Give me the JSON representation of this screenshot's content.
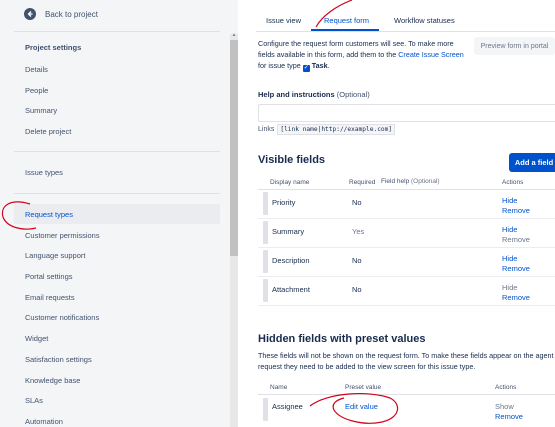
{
  "sidebar": {
    "back_label": "Back to project",
    "section_title": "Project settings",
    "items": [
      {
        "label": "Details"
      },
      {
        "label": "People"
      },
      {
        "label": "Summary"
      },
      {
        "label": "Delete project"
      },
      {
        "label": "Issue types"
      },
      {
        "label": "Request types",
        "active": true
      },
      {
        "label": "Customer permissions"
      },
      {
        "label": "Language support"
      },
      {
        "label": "Portal settings"
      },
      {
        "label": "Email requests"
      },
      {
        "label": "Customer notifications"
      },
      {
        "label": "Widget"
      },
      {
        "label": "Satisfaction settings"
      },
      {
        "label": "Knowledge base"
      },
      {
        "label": "SLAs"
      },
      {
        "label": "Automation"
      }
    ]
  },
  "tabs": [
    {
      "label": "Issue view"
    },
    {
      "label": "Request form",
      "active": true
    },
    {
      "label": "Workflow statuses"
    }
  ],
  "description": {
    "text_before": "Configure the request form customers will see. To make more fields available in this form, add them to the ",
    "link": "Create Issue Screen",
    "text_middle": " for issue type ",
    "issue_type": "Task",
    "text_end": "."
  },
  "preview_button": "Preview form in portal",
  "help": {
    "title": "Help and instructions",
    "optional": "(Optional)",
    "input_value": "",
    "links_label": "Links",
    "links_example": "[link name|http://example.com]"
  },
  "visible_fields": {
    "title": "Visible fields",
    "add_button": "Add a field",
    "columns": {
      "display_name": "Display name",
      "required": "Required",
      "field_help": "Field help",
      "field_help_optional": "(Optional)",
      "actions": "Actions"
    },
    "rows": [
      {
        "name": "Priority",
        "required": "No",
        "action1": "Hide",
        "action2": "Remove",
        "required_muted": false,
        "action1_enabled": true,
        "action2_enabled": true
      },
      {
        "name": "Summary",
        "required": "Yes",
        "action1": "Hide",
        "action2": "Remove",
        "required_muted": true,
        "action1_enabled": true,
        "action2_enabled": false
      },
      {
        "name": "Description",
        "required": "No",
        "action1": "Hide",
        "action2": "Remove",
        "required_muted": false,
        "action1_enabled": true,
        "action2_enabled": true
      },
      {
        "name": "Attachment",
        "required": "No",
        "action1": "Hide",
        "action2": "Remove",
        "required_muted": false,
        "action1_enabled": false,
        "action2_enabled": true
      }
    ]
  },
  "hidden_fields": {
    "title": "Hidden fields with preset values",
    "description": "These fields will not be shown on the request form. To make these fields appear on the agent request they need to be added to the view screen for this issue type.",
    "columns": {
      "name": "Name",
      "preset": "Preset value",
      "actions": "Actions"
    },
    "rows": [
      {
        "name": "Assignee",
        "preset": "Edit value",
        "action1": "Show",
        "action2": "Remove",
        "action1_enabled": false,
        "action2_enabled": true
      }
    ]
  },
  "colors": {
    "accent": "#0052cc",
    "annotation": "#d0021b",
    "sidebar_bg": "#f4f5f7"
  },
  "icons": {
    "back": "arrow-left-circle-icon",
    "checkbox": "checkbox-checked-icon",
    "drag": "drag-handle-icon"
  }
}
